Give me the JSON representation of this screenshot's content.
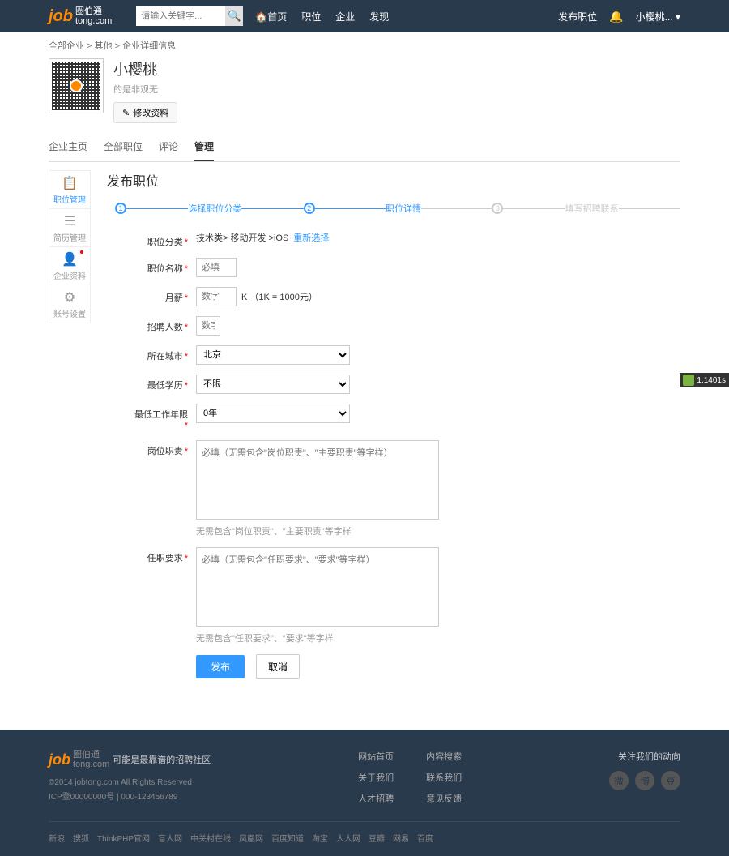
{
  "header": {
    "logo_main": "job",
    "logo_cn_top": "圈伯通",
    "logo_cn_sub": "tong.com",
    "search_placeholder": "请输入关键字...",
    "nav": [
      "首页",
      "职位",
      "企业",
      "发现"
    ],
    "post_job": "发布职位",
    "user_name": "小樱桃..."
  },
  "breadcrumb": {
    "parts": [
      "全部企业",
      "其他",
      "企业详细信息"
    ],
    "sep": " > "
  },
  "company": {
    "name": "小樱桃",
    "subtitle": "的是非观无",
    "edit_btn": "修改资料"
  },
  "tabs": [
    "企业主页",
    "全部职位",
    "评论",
    "管理"
  ],
  "active_tab": 3,
  "sidebar": [
    {
      "icon": "📋",
      "label": "职位管理",
      "active": true
    },
    {
      "icon": "☰",
      "label": "简历管理"
    },
    {
      "icon": "👤",
      "label": "企业资料",
      "dot": true
    },
    {
      "icon": "⚙",
      "label": "账号设置"
    }
  ],
  "page_title": "发布职位",
  "steps": [
    {
      "num": "1",
      "label": "选择职位分类",
      "active": true
    },
    {
      "num": "2",
      "label": "职位详情",
      "active": true
    },
    {
      "num": "3",
      "label": "填写招聘联系",
      "active": false
    }
  ],
  "form": {
    "category": {
      "label": "职位分类",
      "value": "技术类> 移动开发 >iOS",
      "reselect": "重新选择"
    },
    "name": {
      "label": "职位名称",
      "placeholder": "必填"
    },
    "salary": {
      "label": "月薪",
      "placeholder": "数字",
      "unit": "K （1K = 1000元）"
    },
    "headcount": {
      "label": "招聘人数",
      "placeholder": "数字"
    },
    "city": {
      "label": "所在城市",
      "value": "北京"
    },
    "education": {
      "label": "最低学历",
      "value": "不限"
    },
    "experience": {
      "label": "最低工作年限",
      "value": "0年"
    },
    "duty": {
      "label": "岗位职责",
      "placeholder": "必填（无需包含\"岗位职责\"、\"主要职责\"等字样）",
      "hint": "无需包含\"岗位职责\"、\"主要职责\"等字样"
    },
    "requirement": {
      "label": "任职要求",
      "placeholder": "必填（无需包含\"任职要求\"、\"要求\"等字样）",
      "hint": "无需包含\"任职要求\"、\"要求\"等字样"
    },
    "submit": "发布",
    "cancel": "取消"
  },
  "footer": {
    "slogan": "可能是最靠谱的招聘社区",
    "copyright": "©2014 jobtong.com All Rights Reserved",
    "icp": "ICP登00000000号 | 000-123456789",
    "links_col1": [
      "网站首页",
      "关于我们",
      "人才招聘"
    ],
    "links_col2": [
      "内容搜索",
      "联系我们",
      "意见反馈"
    ],
    "follow": "关注我们的动向",
    "social": [
      "微",
      "博",
      "豆"
    ],
    "bottom_links": [
      "新浪",
      "搜狐",
      "ThinkPHP官网",
      "盲人网",
      "中关村在线",
      "凤凰网",
      "百度知道",
      "淘宝",
      "人人网",
      "豆瓣",
      "网易",
      "百度"
    ]
  },
  "perf": "1.1401s"
}
